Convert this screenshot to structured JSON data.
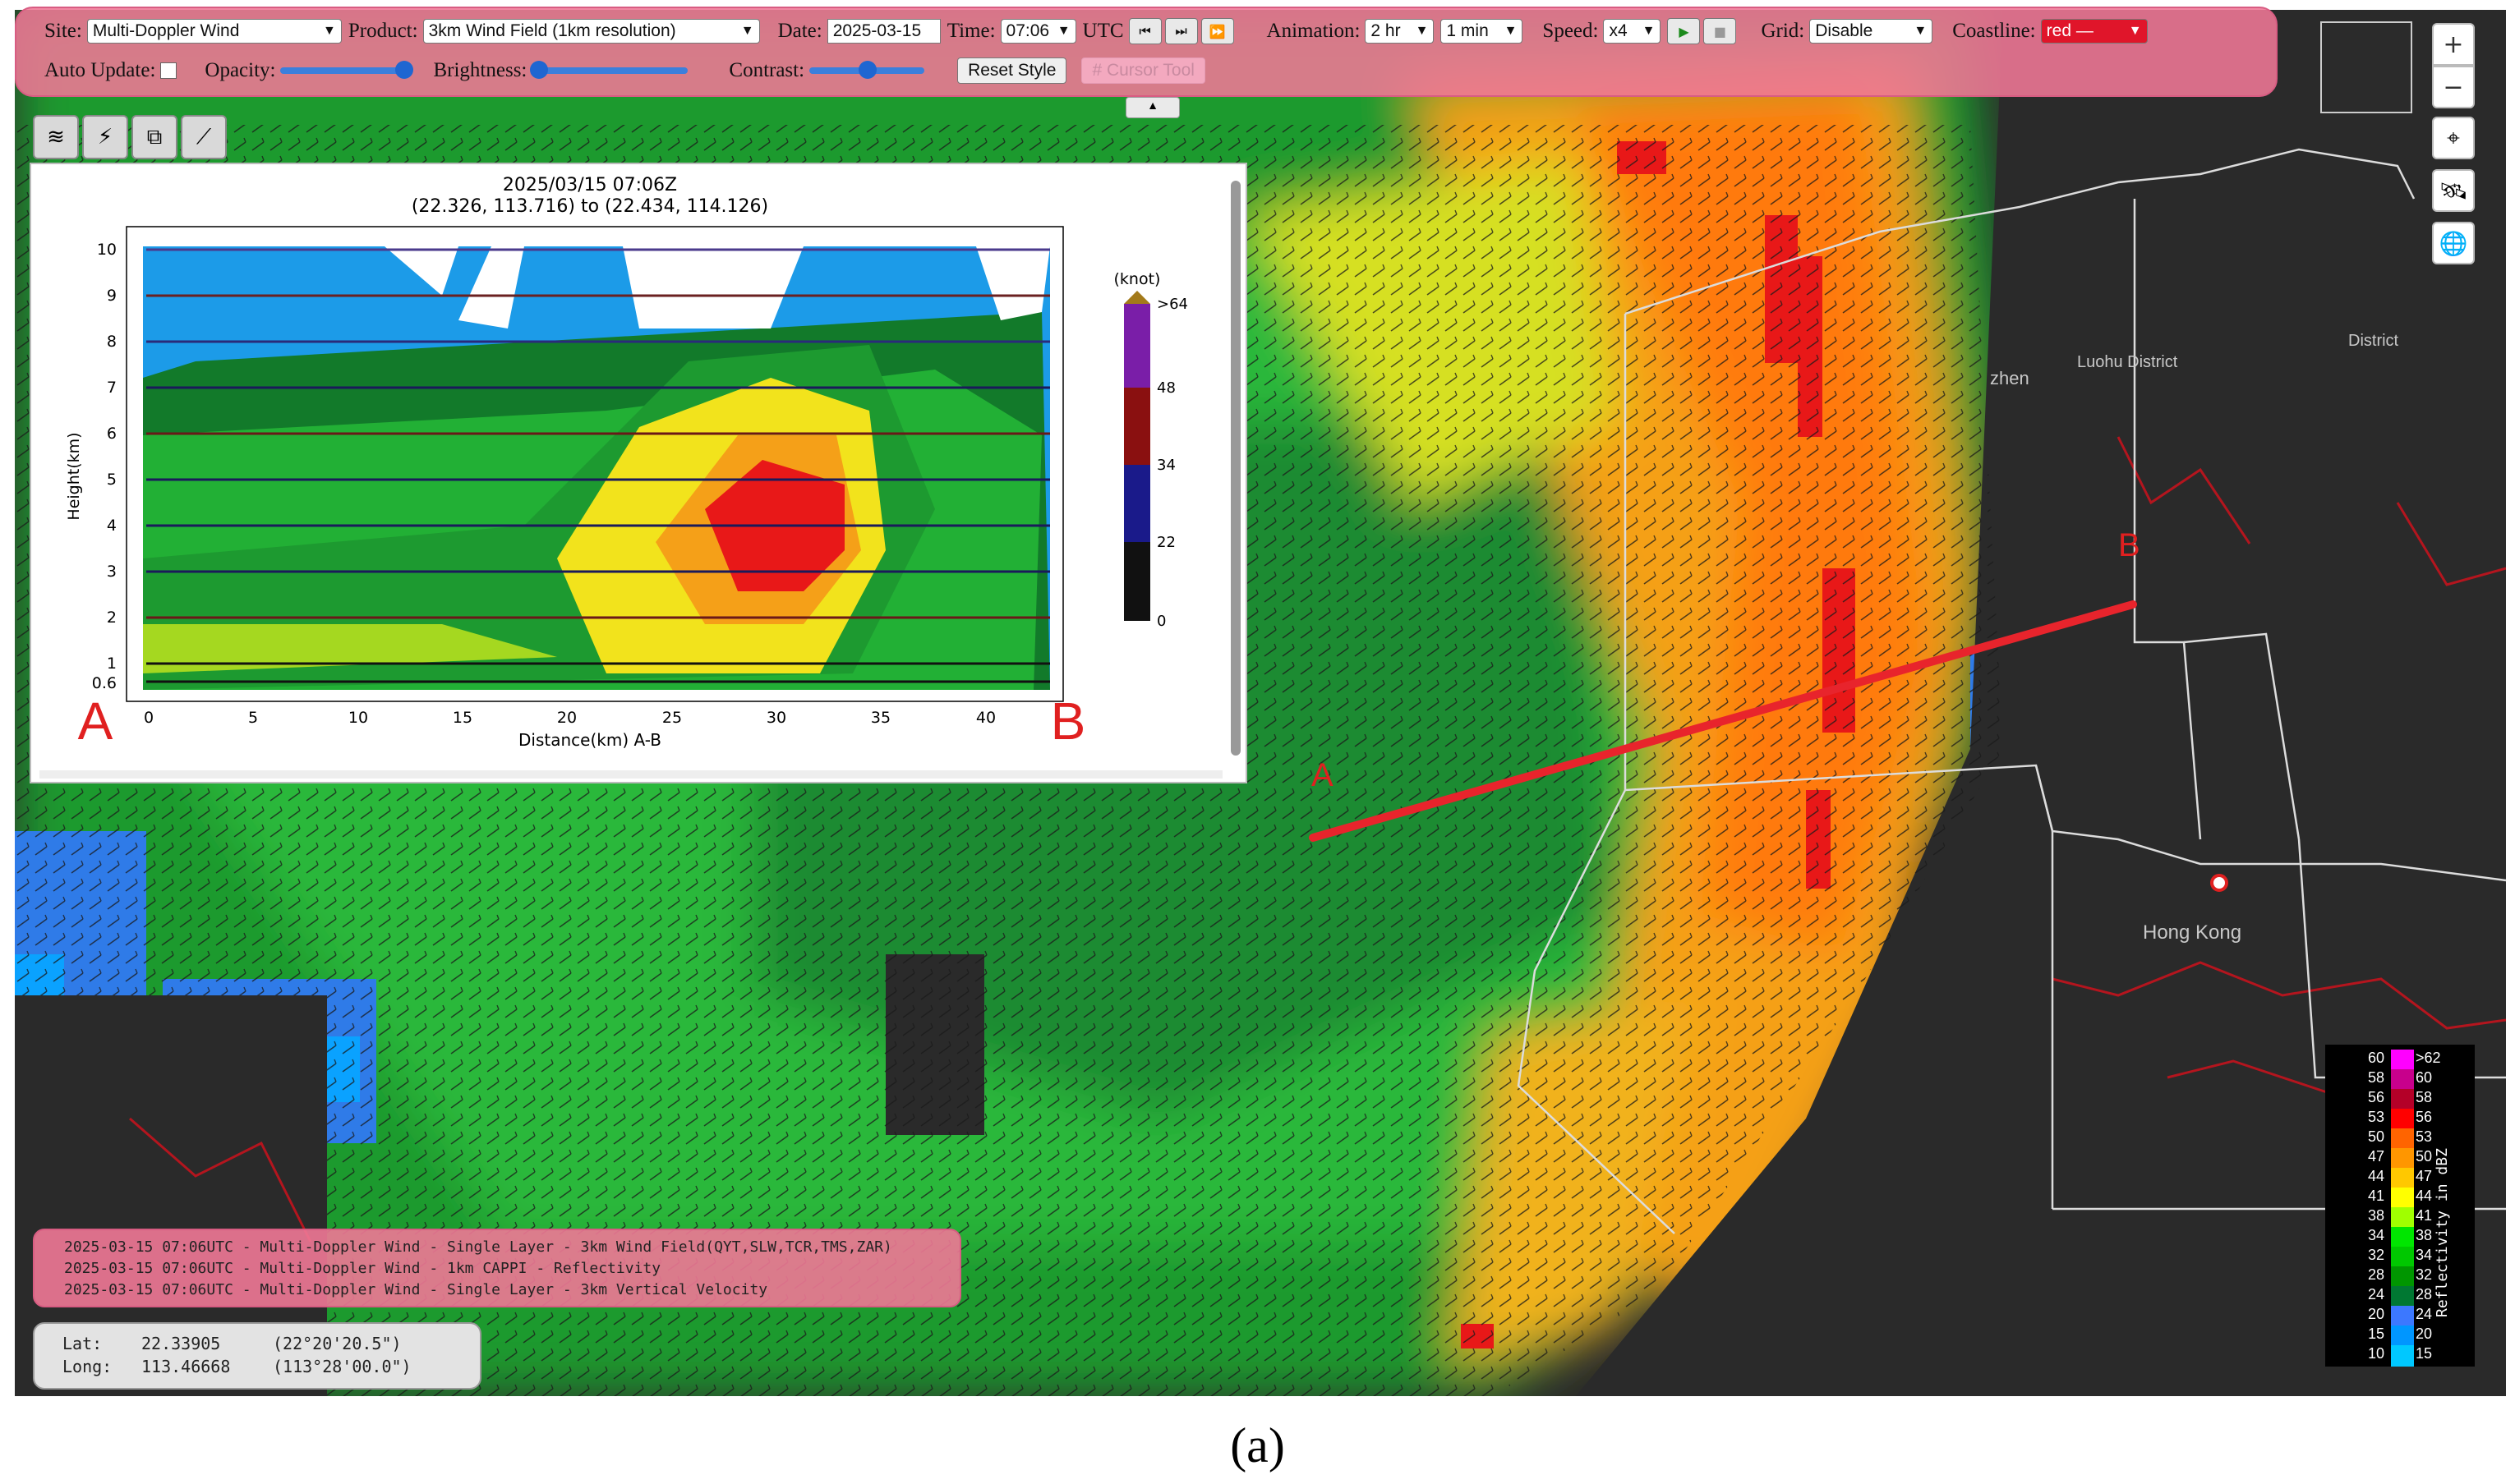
{
  "toolbar": {
    "site_label": "Site:",
    "site_value": "Multi-Doppler Wind",
    "product_label": "Product:",
    "product_value": "3km Wind Field (1km resolution)",
    "date_label": "Date:",
    "date_value": "2025-03-15",
    "time_label": "Time:",
    "time_value": "07:06",
    "utc_label": "UTC",
    "animation_label": "Animation:",
    "animation_span": "2 hr",
    "animation_step": "1 min",
    "speed_label": "Speed:",
    "speed_value": "x4",
    "grid_label": "Grid:",
    "grid_value": "Disable",
    "coastline_label": "Coastline:",
    "coastline_value": "red —",
    "coastline_color": "#e0152a",
    "auto_update_label": "Auto Update:",
    "opacity_label": "Opacity:",
    "brightness_label": "Brightness:",
    "contrast_label": "Contrast:",
    "reset_label": "Reset Style",
    "cursor_tool_label": "# Cursor Tool",
    "opacity_level": 0.95,
    "brightness_level": 0.05,
    "contrast_level": 0.5
  },
  "cross_section": {
    "timestamp": "2025/03/15 07:06Z",
    "coords": "(22.326, 113.716) to (22.434, 114.126)",
    "ylabel": "Height(km)",
    "xlabel": "Distance(km) A-B",
    "yticks": [
      "10",
      "9",
      "8",
      "7",
      "6",
      "5",
      "4",
      "3",
      "2",
      "1",
      "0.6"
    ],
    "xticks": [
      "0",
      "5",
      "10",
      "15",
      "20",
      "25",
      "30",
      "35",
      "40"
    ],
    "end_a": "A",
    "end_b": "B",
    "colorbar_unit": "(knot)",
    "colorbar_ticks": [
      ">64",
      "48",
      "34",
      "22",
      "0"
    ]
  },
  "map": {
    "point_a": "A",
    "point_b": "B",
    "place_hk": "Hong Kong",
    "place_luohu": "Luohu District",
    "place_zhen": "zhen",
    "place_district": "District",
    "section_line_color": "#e8242c"
  },
  "layers": [
    "2025-03-15 07:06UTC - Multi-Doppler Wind - Single Layer - 3km Wind Field(QYT,SLW,TCR,TMS,ZAR)",
    "2025-03-15 07:06UTC - Multi-Doppler Wind - 1km CAPPI - Reflectivity",
    "2025-03-15 07:06UTC - Multi-Doppler Wind - Single Layer - 3km Vertical Velocity"
  ],
  "cursor": {
    "lat_label": "Lat:",
    "lat_value": "22.33905",
    "lat_dms": "(22°20'20.5\")",
    "long_label": "Long:",
    "long_value": "113.46668",
    "long_dms": "(113°28'00.0\")"
  },
  "legend": {
    "title": "Reflectivity in dBZ",
    "rows": [
      {
        "lo": "60",
        "hi": ">62",
        "color": "#ff00ff"
      },
      {
        "lo": "58",
        "hi": "60",
        "color": "#c8008c"
      },
      {
        "lo": "56",
        "hi": "58",
        "color": "#b40028"
      },
      {
        "lo": "53",
        "hi": "56",
        "color": "#ff0000"
      },
      {
        "lo": "50",
        "hi": "53",
        "color": "#ff6400"
      },
      {
        "lo": "47",
        "hi": "50",
        "color": "#ff9600"
      },
      {
        "lo": "44",
        "hi": "47",
        "color": "#ffc800"
      },
      {
        "lo": "41",
        "hi": "44",
        "color": "#ffff00"
      },
      {
        "lo": "38",
        "hi": "41",
        "color": "#a0ff00"
      },
      {
        "lo": "34",
        "hi": "38",
        "color": "#00e600"
      },
      {
        "lo": "32",
        "hi": "34",
        "color": "#00c800"
      },
      {
        "lo": "28",
        "hi": "32",
        "color": "#009600"
      },
      {
        "lo": "24",
        "hi": "28",
        "color": "#007832"
      },
      {
        "lo": "20",
        "hi": "24",
        "color": "#3c78ff"
      },
      {
        "lo": "15",
        "hi": "20",
        "color": "#0096ff"
      },
      {
        "lo": "10",
        "hi": "15",
        "color": "#00c8ff"
      }
    ]
  },
  "icons": [
    "layers-icon",
    "lightning-icon",
    "overlay-icon",
    "chart-line-icon",
    "zoom-in-icon",
    "zoom-out-icon",
    "locate-icon",
    "satellite-icon",
    "globe-icon",
    "play-icon",
    "stop-icon",
    "step-back-icon",
    "step-forward-icon",
    "fast-forward-icon"
  ],
  "caption": "(a)"
}
